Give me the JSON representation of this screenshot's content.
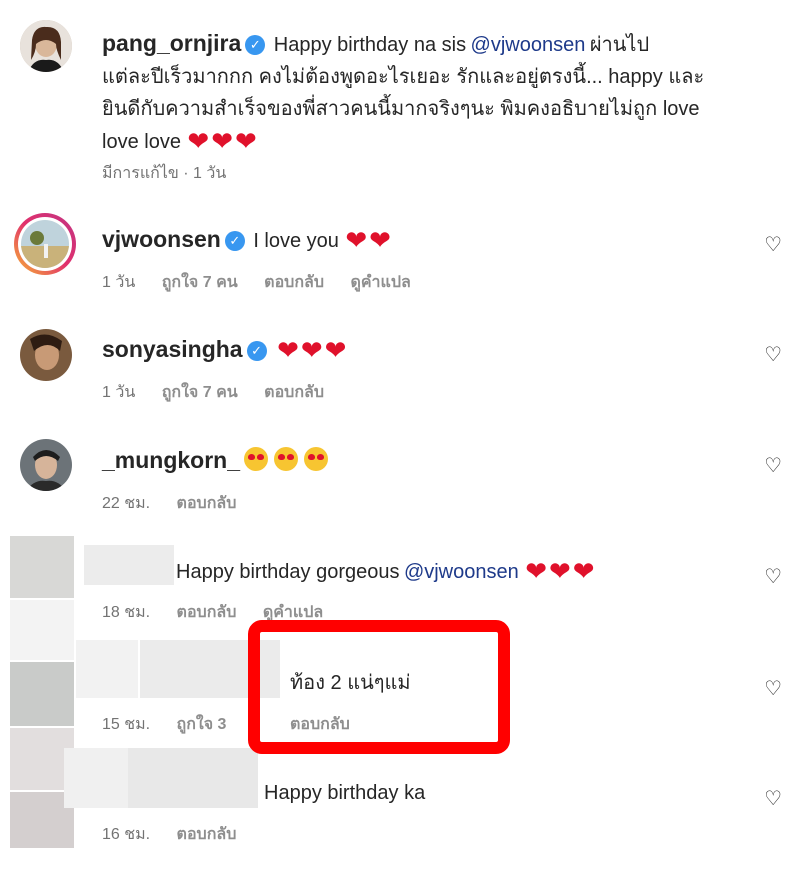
{
  "comments": [
    {
      "username": "pang_ornjira",
      "verified": true,
      "text_line1": "Happy birthday na sis",
      "mention": "@vjwoonsen",
      "text_line1b": "ผ่านไป",
      "text_line2": "แต่ละปีเร็วมากกก คงไม่ต้องพูดอะไรเยอะ รักและอยู่ตรงนี้... happy และ",
      "text_line3": "ยินดีกับความสำเร็จของพี่สาวคนนี้มากจริงๆนะ พิมคงอธิบายไม่ถูก love",
      "text_line4": "love love",
      "meta": "มีการแก้ไข · 1 วัน"
    },
    {
      "username": "vjwoonsen",
      "verified": true,
      "text": "I love you",
      "time": "1 วัน",
      "likes": "ถูกใจ 7 คน",
      "reply": "ตอบกลับ",
      "translate": "ดูคำแปล"
    },
    {
      "username": "sonyasingha",
      "verified": true,
      "time": "1 วัน",
      "likes": "ถูกใจ 7 คน",
      "reply": "ตอบกลับ"
    },
    {
      "username": "_mungkorn_",
      "time": "22 ชม.",
      "reply": "ตอบกลับ"
    },
    {
      "text": "Happy birthday gorgeous",
      "mention": "@vjwoonsen",
      "time": "18 ชม.",
      "reply": "ตอบกลับ",
      "translate": "ดูคำแปล"
    },
    {
      "text": "ท้อง 2 แน่ๆแม่",
      "time": "15 ชม.",
      "likes": "ถูกใจ 3",
      "reply": "ตอบกลับ"
    },
    {
      "text": "Happy birthday ka",
      "time": "16 ชม.",
      "reply": "ตอบกลับ"
    }
  ],
  "icons": {
    "heart_like": "heart-outline-icon",
    "verified": "verified-badge-icon"
  },
  "colors": {
    "highlight": "#ff0000",
    "heart": "#e0112b",
    "verified": "#3897f0"
  }
}
